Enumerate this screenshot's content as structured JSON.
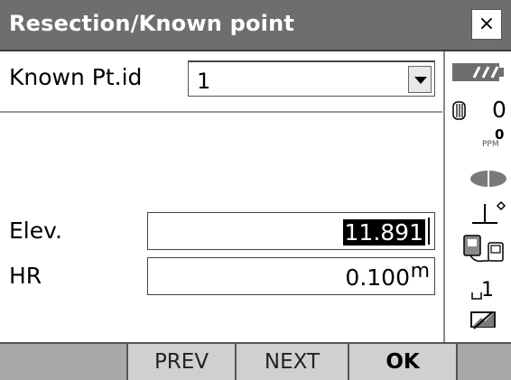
{
  "window": {
    "title": "Resection/Known point",
    "close_label": "×"
  },
  "form": {
    "known_pt": {
      "label": "Known Pt.id",
      "value": "1"
    },
    "elev": {
      "label": "Elev.",
      "value": "11.891"
    },
    "hr": {
      "label": "HR",
      "value": "0.100",
      "unit": "m"
    }
  },
  "status": {
    "prism_constant": "0",
    "ppm_value": "0",
    "ppm_label": "PPM",
    "input_mode": "1"
  },
  "softkeys": [
    "",
    "PREV",
    "NEXT",
    "OK",
    ""
  ]
}
